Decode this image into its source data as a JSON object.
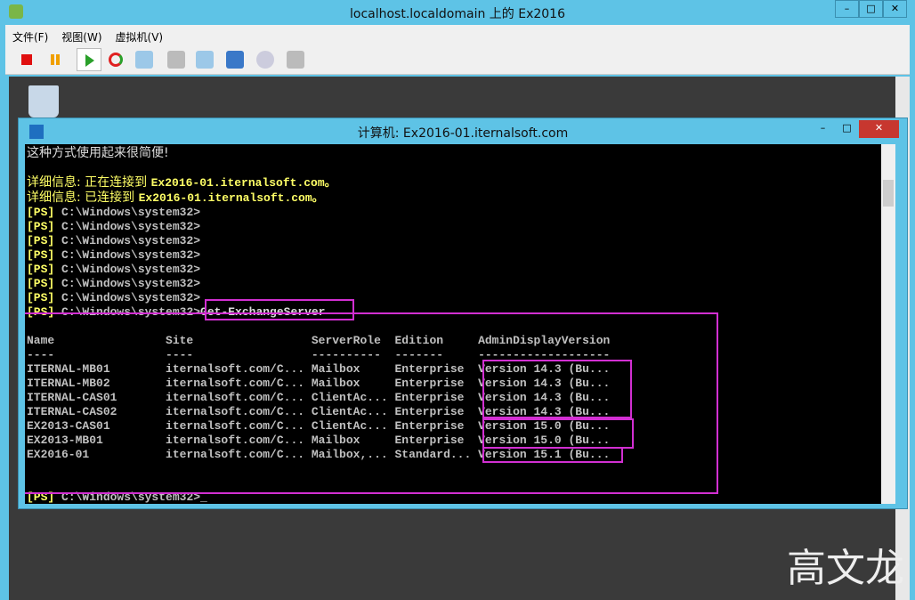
{
  "window": {
    "title": "localhost.localdomain 上的 Ex2016",
    "min": "–",
    "max": "□",
    "close": "✕"
  },
  "menu": [
    "文件(F)",
    "视图(W)",
    "虚拟机(V)"
  ],
  "toolbar": [
    "stop-icon",
    "pause-icon",
    "play-icon",
    "reset-icon",
    "snapshot-icon",
    "revert-icon",
    "manage-snapshots-icon",
    "settings-icon",
    "cd-icon",
    "usb-icon"
  ],
  "console_window": {
    "title": "计算机: Ex2016-01.iternalsoft.com",
    "min": "–",
    "max": "□",
    "close": "✕"
  },
  "console": {
    "intro": "这种方式使用起来很简便!",
    "verbose": [
      {
        "label": "详细信息: 正在连接到 ",
        "host": "Ex2016-01.iternalsoft.com。"
      },
      {
        "label": "详细信息: 已连接到 ",
        "host": "Ex2016-01.iternalsoft.com。"
      }
    ],
    "prompt_tag": "[PS]",
    "prompt": " C:\\Windows\\system32>",
    "prompt_count": 7,
    "command": "Get-ExchangeServer",
    "headers": [
      "Name",
      "Site",
      "ServerRole",
      "Edition",
      "AdminDisplayVersion"
    ],
    "underline": [
      "----",
      "----",
      "----------",
      "-------",
      "-------------------"
    ],
    "rows": [
      [
        "ITERNAL-MB01",
        "iternalsoft.com/C...",
        "Mailbox",
        "Enterprise",
        "Version 14.3 (Bu..."
      ],
      [
        "ITERNAL-MB02",
        "iternalsoft.com/C...",
        "Mailbox",
        "Enterprise",
        "Version 14.3 (Bu..."
      ],
      [
        "ITERNAL-CAS01",
        "iternalsoft.com/C...",
        "ClientAc...",
        "Enterprise",
        "Version 14.3 (Bu..."
      ],
      [
        "ITERNAL-CAS02",
        "iternalsoft.com/C...",
        "ClientAc...",
        "Enterprise",
        "Version 14.3 (Bu..."
      ],
      [
        "EX2013-CAS01",
        "iternalsoft.com/C...",
        "ClientAc...",
        "Enterprise",
        "Version 15.0 (Bu..."
      ],
      [
        "EX2013-MB01",
        "iternalsoft.com/C...",
        "Mailbox",
        "Enterprise",
        "Version 15.0 (Bu..."
      ],
      [
        "EX2016-01",
        "iternalsoft.com/C...",
        "Mailbox,...",
        "Standard...",
        "Version 15.1 (Bu..."
      ]
    ]
  },
  "watermark": "高文龙",
  "colors": {
    "titlebar": "#5ec3e6",
    "highlight": "#d22fd2",
    "prompt": "#ffff66"
  }
}
